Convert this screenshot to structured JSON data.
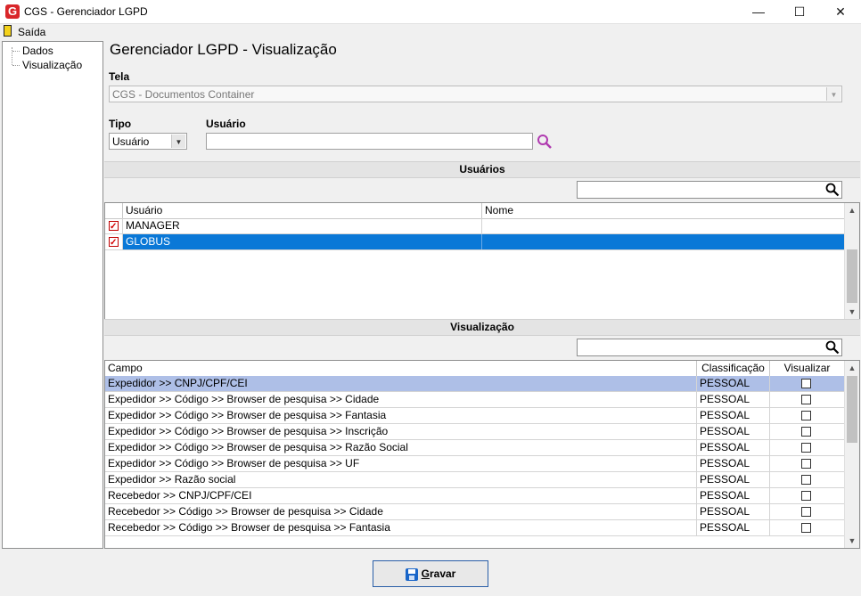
{
  "window": {
    "title": "CGS - Gerenciador LGPD",
    "logo_letter": "G"
  },
  "menu": {
    "exit_label": "Saída"
  },
  "tree": {
    "items": [
      "Dados",
      "Visualização"
    ]
  },
  "page": {
    "title": "Gerenciador LGPD - Visualização"
  },
  "form": {
    "tela_label": "Tela",
    "tela_value": "CGS - Documentos Container",
    "tipo_label": "Tipo",
    "tipo_value": "Usuário",
    "usuario_label": "Usuário",
    "usuario_value": ""
  },
  "usuarios": {
    "section_title": "Usuários",
    "columns": [
      "Usuário",
      "Nome"
    ],
    "rows": [
      {
        "checked": true,
        "usuario": "MANAGER",
        "nome": ""
      },
      {
        "checked": true,
        "usuario": "GLOBUS",
        "nome": ""
      }
    ]
  },
  "visualizacao": {
    "section_title": "Visualização",
    "columns": [
      "Campo",
      "Classificação",
      "Visualizar"
    ],
    "rows": [
      {
        "campo": "Expedidor >> CNPJ/CPF/CEI",
        "classificacao": "PESSOAL",
        "visualizar": false
      },
      {
        "campo": "Expedidor >> Código >> Browser de pesquisa >> Cidade",
        "classificacao": "PESSOAL",
        "visualizar": false
      },
      {
        "campo": "Expedidor >> Código >> Browser de pesquisa >> Fantasia",
        "classificacao": "PESSOAL",
        "visualizar": false
      },
      {
        "campo": "Expedidor >> Código >> Browser de pesquisa >> Inscrição",
        "classificacao": "PESSOAL",
        "visualizar": false
      },
      {
        "campo": "Expedidor >> Código >> Browser de pesquisa >> Razão Social",
        "classificacao": "PESSOAL",
        "visualizar": false
      },
      {
        "campo": "Expedidor >> Código >> Browser de pesquisa >> UF",
        "classificacao": "PESSOAL",
        "visualizar": false
      },
      {
        "campo": "Expedidor >> Razão social",
        "classificacao": "PESSOAL",
        "visualizar": false
      },
      {
        "campo": "Recebedor >> CNPJ/CPF/CEI",
        "classificacao": "PESSOAL",
        "visualizar": false
      },
      {
        "campo": "Recebedor >> Código >> Browser de pesquisa >> Cidade",
        "classificacao": "PESSOAL",
        "visualizar": false
      },
      {
        "campo": "Recebedor >> Código >> Browser de pesquisa >> Fantasia",
        "classificacao": "PESSOAL",
        "visualizar": false
      }
    ]
  },
  "footer": {
    "save_label": "Gravar",
    "save_mnemonic": "G",
    "save_rest": "ravar"
  },
  "colors": {
    "selection": "#0a78d7",
    "selection_light": "#aebfe7",
    "logo": "#d9262a"
  }
}
